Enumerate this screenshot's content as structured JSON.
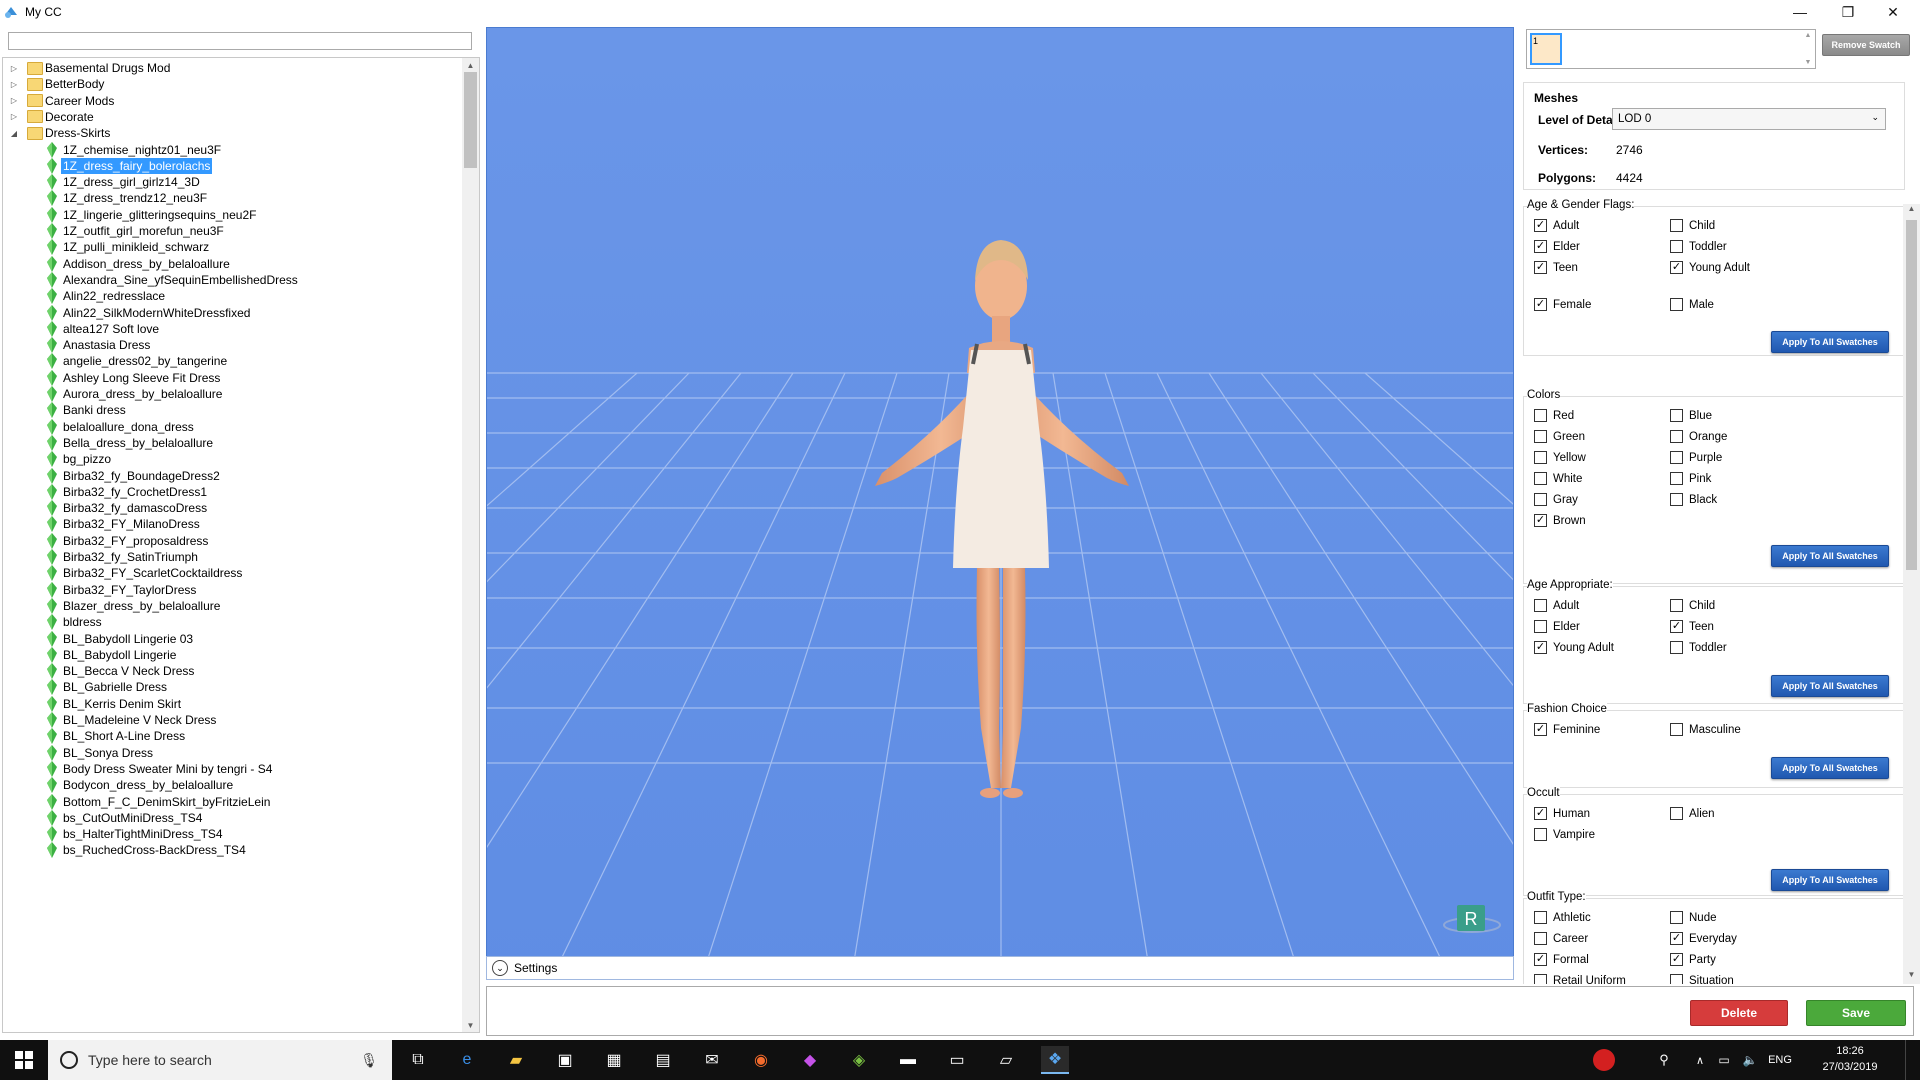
{
  "window": {
    "title": "My CC",
    "minimize": "—",
    "maximize": "❐",
    "close": "✕"
  },
  "search": {
    "value": ""
  },
  "tree": {
    "items": [
      {
        "label": "Basemental Drugs Mod",
        "type": "folder",
        "expanded": false
      },
      {
        "label": "BetterBody",
        "type": "folder",
        "expanded": false
      },
      {
        "label": "Career Mods",
        "type": "folder",
        "expanded": false
      },
      {
        "label": "Decorate",
        "type": "folder",
        "expanded": false
      },
      {
        "label": "Dress-Skirts",
        "type": "folder",
        "expanded": true
      },
      {
        "label": "1Z_chemise_nightz01_neu3F",
        "type": "item"
      },
      {
        "label": "1Z_dress_fairy_bolerolachs",
        "type": "item",
        "selected": true
      },
      {
        "label": "1Z_dress_girl_girlz14_3D",
        "type": "item"
      },
      {
        "label": "1Z_dress_trendz12_neu3F",
        "type": "item"
      },
      {
        "label": "1Z_lingerie_glitteringsequins_neu2F",
        "type": "item"
      },
      {
        "label": "1Z_outfit_girl_morefun_neu3F",
        "type": "item"
      },
      {
        "label": "1Z_pulli_minikleid_schwarz",
        "type": "item"
      },
      {
        "label": "Addison_dress_by_belaloallure",
        "type": "item"
      },
      {
        "label": "Alexandra_Sine_yfSequinEmbellishedDress",
        "type": "item"
      },
      {
        "label": "Alin22_redresslace",
        "type": "item"
      },
      {
        "label": "Alin22_SilkModernWhiteDressfixed",
        "type": "item"
      },
      {
        "label": "altea127 Soft love",
        "type": "item"
      },
      {
        "label": "Anastasia Dress",
        "type": "item"
      },
      {
        "label": "angelie_dress02_by_tangerine",
        "type": "item"
      },
      {
        "label": "Ashley Long Sleeve Fit Dress",
        "type": "item"
      },
      {
        "label": "Aurora_dress_by_belaloallure",
        "type": "item"
      },
      {
        "label": "Banki dress",
        "type": "item"
      },
      {
        "label": "belaloallure_dona_dress",
        "type": "item"
      },
      {
        "label": "Bella_dress_by_belaloallure",
        "type": "item"
      },
      {
        "label": "bg_pizzo",
        "type": "item"
      },
      {
        "label": "Birba32_fy_BoundageDress2",
        "type": "item"
      },
      {
        "label": "Birba32_fy_CrochetDress1",
        "type": "item"
      },
      {
        "label": "Birba32_fy_damascoDress",
        "type": "item"
      },
      {
        "label": "Birba32_FY_MilanoDress",
        "type": "item"
      },
      {
        "label": "Birba32_FY_proposaldress",
        "type": "item"
      },
      {
        "label": "Birba32_fy_SatinTriumph",
        "type": "item"
      },
      {
        "label": "Birba32_FY_ScarletCocktaildress",
        "type": "item"
      },
      {
        "label": "Birba32_FY_TaylorDress",
        "type": "item"
      },
      {
        "label": "Blazer_dress_by_belaloallure",
        "type": "item"
      },
      {
        "label": "bldress",
        "type": "item"
      },
      {
        "label": "BL_Babydoll Lingerie 03",
        "type": "item"
      },
      {
        "label": "BL_Babydoll Lingerie",
        "type": "item"
      },
      {
        "label": "BL_Becca V Neck Dress",
        "type": "item"
      },
      {
        "label": "BL_Gabrielle Dress",
        "type": "item"
      },
      {
        "label": "BL_Kerris Denim Skirt",
        "type": "item"
      },
      {
        "label": "BL_Madeleine V Neck Dress",
        "type": "item"
      },
      {
        "label": "BL_Short A-Line Dress",
        "type": "item"
      },
      {
        "label": "BL_Sonya Dress",
        "type": "item"
      },
      {
        "label": "Body Dress Sweater Mini by tengri - S4",
        "type": "item"
      },
      {
        "label": "Bodycon_dress_by_belaloallure",
        "type": "item"
      },
      {
        "label": "Bottom_F_C_DenimSkirt_byFritzieLein",
        "type": "item"
      },
      {
        "label": "bs_CutOutMiniDress_TS4",
        "type": "item"
      },
      {
        "label": "bs_HalterTightMiniDress_TS4",
        "type": "item"
      },
      {
        "label": "bs_RuchedCross-BackDress_TS4",
        "type": "item"
      }
    ]
  },
  "viewport": {
    "settings_label": "Settings",
    "badge": "R"
  },
  "swatch": {
    "value": "1",
    "remove_label": "Remove Swatch"
  },
  "meshes": {
    "title": "Meshes",
    "lod_label": "Level of Detail",
    "lod_value": "LOD 0",
    "vertices_label": "Vertices:",
    "vertices_value": "2746",
    "polygons_label": "Polygons:",
    "polygons_value": "4424"
  },
  "apply_label": "Apply To All Swatches",
  "age_gender": {
    "title": "Age & Gender Flags:",
    "items": [
      {
        "label": "Adult",
        "checked": true
      },
      {
        "label": "Child",
        "checked": false
      },
      {
        "label": "Elder",
        "checked": true
      },
      {
        "label": "Toddler",
        "checked": false
      },
      {
        "label": "Teen",
        "checked": true
      },
      {
        "label": "Young Adult",
        "checked": true
      },
      {
        "label": "Female",
        "checked": true
      },
      {
        "label": "Male",
        "checked": false
      }
    ]
  },
  "colors": {
    "title": "Colors",
    "items": [
      {
        "label": "Red",
        "checked": false
      },
      {
        "label": "Blue",
        "checked": false
      },
      {
        "label": "Green",
        "checked": false
      },
      {
        "label": "Orange",
        "checked": false
      },
      {
        "label": "Yellow",
        "checked": false
      },
      {
        "label": "Purple",
        "checked": false
      },
      {
        "label": "White",
        "checked": false
      },
      {
        "label": "Pink",
        "checked": false
      },
      {
        "label": "Gray",
        "checked": false
      },
      {
        "label": "Black",
        "checked": false
      },
      {
        "label": "Brown",
        "checked": true
      }
    ]
  },
  "age_appropriate": {
    "title": "Age Appropriate:",
    "items": [
      {
        "label": "Adult",
        "checked": false
      },
      {
        "label": "Child",
        "checked": false
      },
      {
        "label": "Elder",
        "checked": false
      },
      {
        "label": "Teen",
        "checked": true
      },
      {
        "label": "Young Adult",
        "checked": true
      },
      {
        "label": "Toddler",
        "checked": false
      }
    ]
  },
  "fashion": {
    "title": "Fashion Choice",
    "items": [
      {
        "label": "Feminine",
        "checked": true
      },
      {
        "label": "Masculine",
        "checked": false
      }
    ]
  },
  "occult": {
    "title": "Occult",
    "items": [
      {
        "label": "Human",
        "checked": true
      },
      {
        "label": "Alien",
        "checked": false
      },
      {
        "label": "Vampire",
        "checked": false
      }
    ]
  },
  "outfit": {
    "title": "Outfit Type:",
    "items": [
      {
        "label": "Athletic",
        "checked": false
      },
      {
        "label": "Nude",
        "checked": false
      },
      {
        "label": "Career",
        "checked": false
      },
      {
        "label": "Everyday",
        "checked": true
      },
      {
        "label": "Formal",
        "checked": true
      },
      {
        "label": "Party",
        "checked": true
      },
      {
        "label": "Retail Uniform",
        "checked": false
      },
      {
        "label": "Situation",
        "checked": false
      }
    ]
  },
  "actions": {
    "delete_label": "Delete",
    "save_label": "Save",
    "delete_color": "#d9534f",
    "save_color": "#5cb85c"
  },
  "taskbar": {
    "search_placeholder": "Type here to search",
    "time": "18:26",
    "date": "27/03/2019",
    "lang": "ENG",
    "app_icons": [
      "task-view-icon",
      "edge-icon",
      "file-explorer-icon",
      "store-icon",
      "calculator-icon",
      "calendar-icon",
      "mail-icon",
      "origin-icon",
      "maps-icon",
      "sims-icon",
      "media-icon",
      "photos-icon",
      "notes-icon",
      "sims4studio-icon"
    ]
  }
}
